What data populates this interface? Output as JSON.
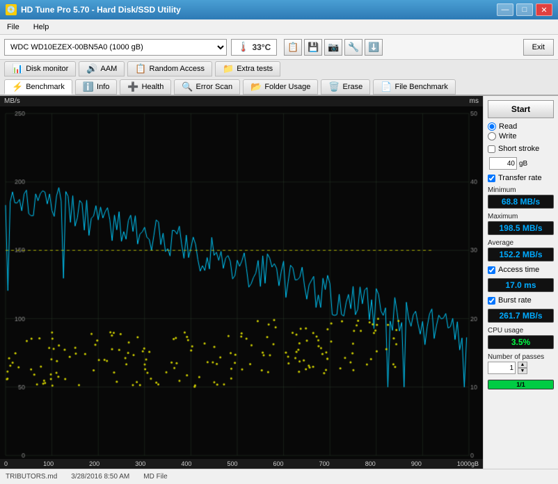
{
  "titleBar": {
    "title": "HD Tune Pro 5.70 - Hard Disk/SSD Utility",
    "icon": "💾",
    "buttons": {
      "minimize": "—",
      "maximize": "□",
      "close": "✕"
    }
  },
  "menuBar": {
    "items": [
      "File",
      "Help"
    ]
  },
  "toolbar": {
    "driveLabel": "WDC WD10EZEX-00BN5A0 (1000 gB)",
    "temperature": "33°C",
    "exitLabel": "Exit"
  },
  "navTabs": {
    "row1": [
      {
        "id": "disk-monitor",
        "icon": "📊",
        "label": "Disk monitor"
      },
      {
        "id": "aam",
        "icon": "🔊",
        "label": "AAM"
      },
      {
        "id": "random-access",
        "icon": "📋",
        "label": "Random Access"
      },
      {
        "id": "extra-tests",
        "icon": "📁",
        "label": "Extra tests"
      }
    ],
    "row2": [
      {
        "id": "benchmark",
        "icon": "⚡",
        "label": "Benchmark",
        "active": true
      },
      {
        "id": "info",
        "icon": "ℹ️",
        "label": "Info"
      },
      {
        "id": "health",
        "icon": "➕",
        "label": "Health"
      },
      {
        "id": "error-scan",
        "icon": "🔍",
        "label": "Error Scan"
      },
      {
        "id": "folder-usage",
        "icon": "📂",
        "label": "Folder Usage"
      },
      {
        "id": "erase",
        "icon": "🗑️",
        "label": "Erase"
      },
      {
        "id": "file-benchmark",
        "icon": "📄",
        "label": "File Benchmark"
      }
    ]
  },
  "chart": {
    "yAxisLeft": {
      "label": "MB/s",
      "values": [
        "250",
        "200",
        "150",
        "100",
        "50"
      ]
    },
    "yAxisRight": {
      "label": "ms",
      "values": [
        "50",
        "40",
        "30",
        "20",
        "10"
      ]
    },
    "xAxis": {
      "label": "gB",
      "values": [
        "0",
        "100",
        "200",
        "300",
        "400",
        "500",
        "600",
        "700",
        "800",
        "900",
        "1000gB"
      ]
    }
  },
  "rightPanel": {
    "startLabel": "Start",
    "readLabel": "Read",
    "writeLabel": "Write",
    "shortStrokeLabel": "Short stroke",
    "strokeValue": "40",
    "strokeUnit": "gB",
    "transferRateLabel": "Transfer rate",
    "minimum": {
      "label": "Minimum",
      "value": "68.8 MB/s"
    },
    "maximum": {
      "label": "Maximum",
      "value": "198.5 MB/s"
    },
    "average": {
      "label": "Average",
      "value": "152.2 MB/s"
    },
    "accessTime": {
      "label": "Access time",
      "value": "17.0 ms"
    },
    "burstRate": {
      "label": "Burst rate",
      "value": "261.7 MB/s"
    },
    "cpuUsage": {
      "label": "CPU usage",
      "value": "3.5%"
    },
    "numberOfPasses": {
      "label": "Number of passes",
      "value": "1"
    },
    "progressLabel": "1/1"
  },
  "statusBar": {
    "items": [
      "TRIBUTORS.md",
      "3/28/2016 8:50 AM",
      "MD File"
    ]
  }
}
